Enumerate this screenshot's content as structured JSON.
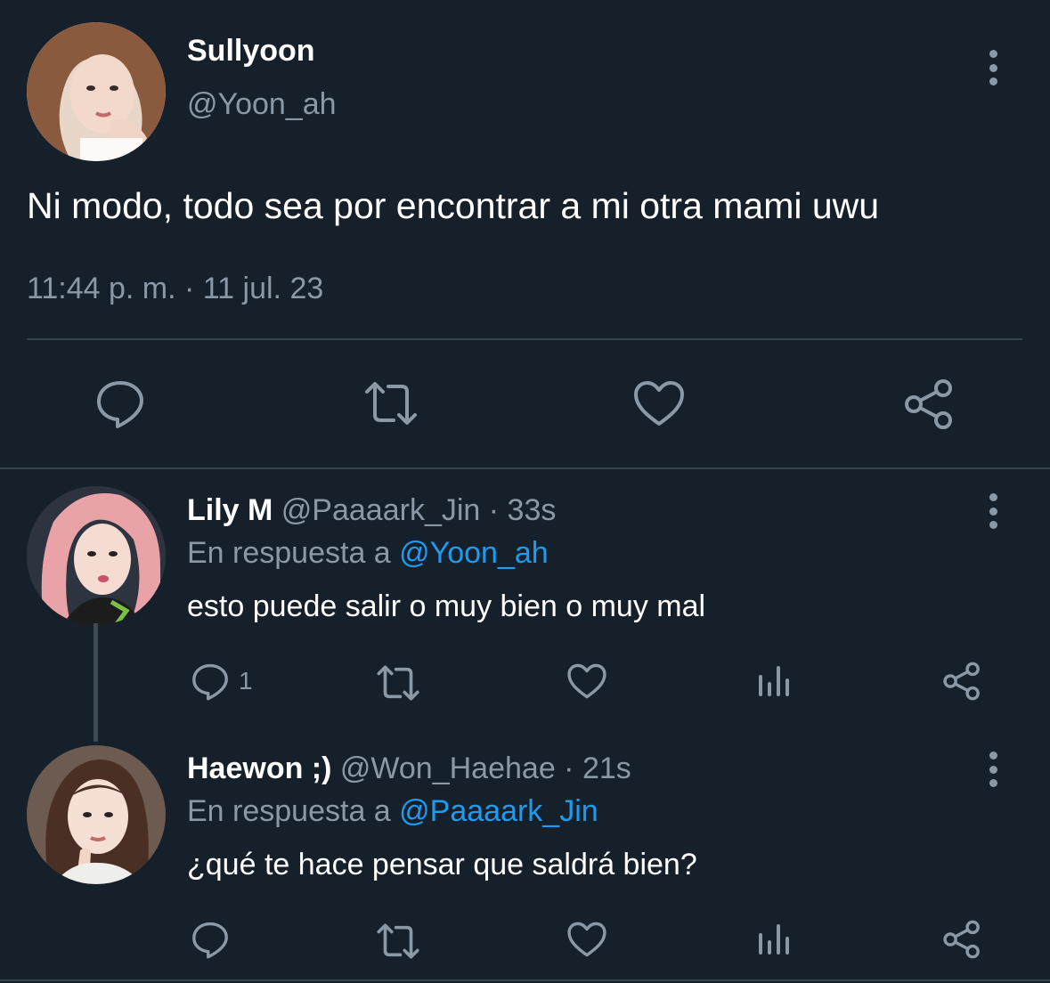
{
  "main_tweet": {
    "display_name": "Sullyoon",
    "handle": "@Yoon_ah",
    "text": "Ni modo, todo sea por encontrar a mi otra mami uwu",
    "timestamp": "11:44 p. m. · 11 jul. 23",
    "actions": [
      "reply-icon",
      "retweet-icon",
      "like-icon",
      "share-icon"
    ]
  },
  "replies": [
    {
      "display_name": "Lily M",
      "handle_time": "@Paaaark_Jin · 33s",
      "in_reply_prefix": "En respuesta a",
      "in_reply_to": "@Yoon_ah",
      "text": "esto puede salir o muy bien o muy mal",
      "reply_count": "1"
    },
    {
      "display_name": "Haewon ;)",
      "handle_time": "@Won_Haehae · 21s",
      "in_reply_prefix": "En respuesta a",
      "in_reply_to": "@Paaaark_Jin",
      "text": "¿qué te hace pensar que saldrá bien?",
      "reply_count": ""
    }
  ],
  "colors": {
    "background": "#15202b",
    "text_primary": "#ffffff",
    "text_secondary": "#8b98a5",
    "mention": "#1d9bf0",
    "divider": "#38444d",
    "icon": "#8b98a5"
  }
}
